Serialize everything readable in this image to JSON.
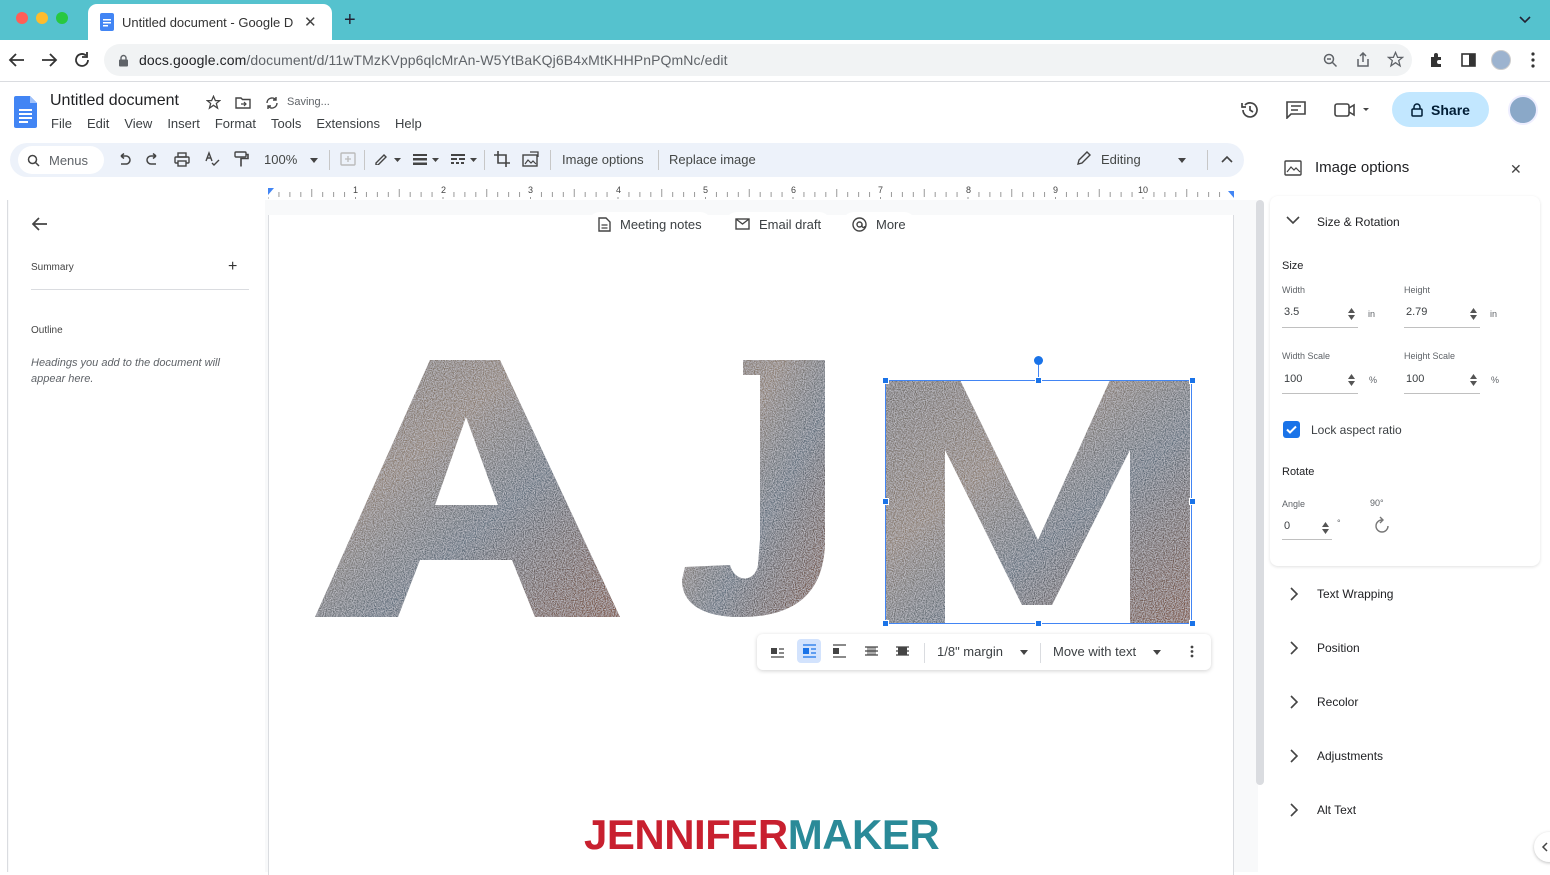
{
  "browser": {
    "tab_title": "Untitled document - Google D",
    "url_host": "docs.google.com",
    "url_path": "/document/d/11wTMzKVpp6qlcMrAn-W5YtBaKQj6B4xMtKHHPnPQmNc/edit"
  },
  "doc": {
    "title": "Untitled document",
    "saving": "Saving...",
    "menus": [
      "File",
      "Edit",
      "View",
      "Insert",
      "Format",
      "Tools",
      "Extensions",
      "Help"
    ],
    "share_label": "Share"
  },
  "toolbar": {
    "menus_label": "Menus",
    "zoom": "100%",
    "image_options": "Image options",
    "replace_image": "Replace image",
    "mode": "Editing"
  },
  "ruler": {
    "marks": [
      "1",
      "2",
      "3",
      "4",
      "5",
      "6",
      "7",
      "8",
      "9",
      "10"
    ]
  },
  "outline": {
    "summary": "Summary",
    "outline": "Outline",
    "hint": "Headings you add to the document will appear here."
  },
  "chips": {
    "meeting": "Meeting notes",
    "email": "Email draft",
    "more": "More"
  },
  "image_toolbar": {
    "margin": "1/8\" margin",
    "wrap": "Move with text"
  },
  "watermark": {
    "part1": "JENNIFER",
    "part2": "MAKER"
  },
  "panel": {
    "title": "Image options",
    "size_rotation": "Size & Rotation",
    "size": "Size",
    "width_label": "Width",
    "height_label": "Height",
    "width_value": "3.5",
    "height_value": "2.79",
    "unit_in": "in",
    "width_scale_label": "Width Scale",
    "height_scale_label": "Height Scale",
    "width_scale_value": "100",
    "height_scale_value": "100",
    "unit_pct": "%",
    "lock_aspect": "Lock aspect ratio",
    "rotate": "Rotate",
    "angle_label": "Angle",
    "angle_value": "0",
    "angle_unit": "°",
    "rot90": "90°",
    "sections": [
      "Text Wrapping",
      "Position",
      "Recolor",
      "Adjustments",
      "Alt Text"
    ]
  },
  "colors": {
    "accent": "#1a73e8",
    "tabbar": "#55c2ce",
    "share_bg": "#c2e7ff",
    "brand_red": "#c8202f",
    "brand_teal": "#2a8a98"
  }
}
